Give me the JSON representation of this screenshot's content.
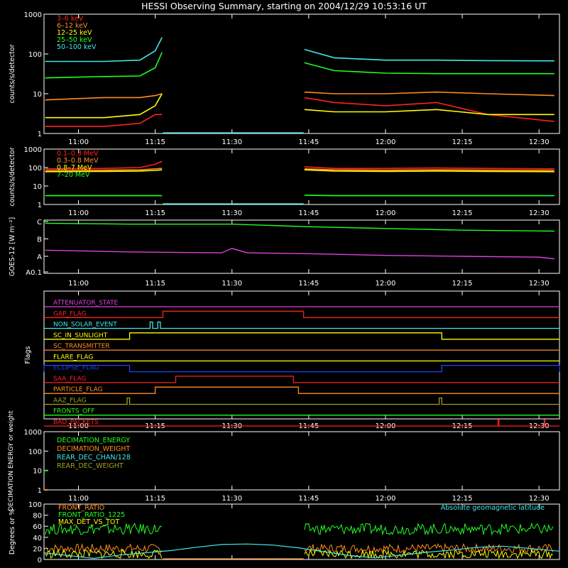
{
  "title": "HESSI Observing Summary, starting on 2004/12/29 10:53:16 UT",
  "time_ticks": [
    "11:00",
    "11:15",
    "11:30",
    "11:45",
    "12:00",
    "12:15",
    "12:30"
  ],
  "colors": {
    "red": "#ff2020",
    "orange": "#ff8c20",
    "yellow": "#ffff00",
    "green": "#20ff20",
    "cyan": "#40e8e8",
    "magenta": "#e040e0",
    "blue": "#2040ff",
    "olive": "#a0a020",
    "grey": "#a8a8a8"
  },
  "chart_data": [
    {
      "type": "line",
      "panel": "lightcurves-low",
      "ylabel": "counts/s/detector",
      "yscale": "log",
      "ylim": [
        1,
        1000
      ],
      "yticks": [
        "1",
        "10",
        "100",
        "1000"
      ],
      "xlim": [
        "10:53:16",
        "12:34:00"
      ],
      "gaps": [
        [
          "11:16:30",
          "11:44:00"
        ]
      ],
      "series": [
        {
          "name": "3–6 keV",
          "color": "#ff2020",
          "t": [
            "10:53:30",
            "11:05",
            "11:12",
            "11:15",
            "11:16:20",
            "11:44:10",
            "11:50",
            "12:00",
            "12:10",
            "12:20",
            "12:33"
          ],
          "values": [
            1.5,
            1.5,
            1.8,
            3,
            3,
            8,
            6,
            5,
            6,
            3,
            2
          ]
        },
        {
          "name": "6–12 keV",
          "color": "#ff8c20",
          "t": [
            "10:53:30",
            "11:05",
            "11:12",
            "11:15",
            "11:16:20",
            "11:44:10",
            "11:50",
            "12:00",
            "12:10",
            "12:20",
            "12:33"
          ],
          "values": [
            7,
            8,
            8,
            9,
            10,
            11,
            10,
            10,
            11,
            10,
            9
          ]
        },
        {
          "name": "12–25 keV",
          "color": "#ffff00",
          "t": [
            "10:53:30",
            "11:05",
            "11:12",
            "11:15",
            "11:16:20",
            "11:44:10",
            "11:50",
            "12:00",
            "12:10",
            "12:20",
            "12:33"
          ],
          "values": [
            2.5,
            2.5,
            3,
            5,
            10,
            4,
            3.5,
            3.5,
            4,
            3,
            3
          ]
        },
        {
          "name": "25–50 keV",
          "color": "#20ff20",
          "t": [
            "10:53:30",
            "11:05",
            "11:12",
            "11:15",
            "11:16:20",
            "11:44:10",
            "11:50",
            "12:00",
            "12:10",
            "12:20",
            "12:33"
          ],
          "values": [
            25,
            27,
            28,
            45,
            110,
            60,
            38,
            33,
            32,
            32,
            32
          ]
        },
        {
          "name": "50–100 keV",
          "color": "#40e8e8",
          "t": [
            "10:53:30",
            "11:05",
            "11:12",
            "11:15",
            "11:16:20",
            "11:44:10",
            "11:50",
            "12:00",
            "12:10",
            "12:20",
            "12:33"
          ],
          "values": [
            65,
            65,
            70,
            120,
            260,
            130,
            80,
            70,
            70,
            68,
            67
          ]
        }
      ]
    },
    {
      "type": "line",
      "panel": "lightcurves-high",
      "ylabel": "counts/s/detector",
      "yscale": "log",
      "ylim": [
        1,
        1000
      ],
      "yticks": [
        "1",
        "10",
        "100",
        "1000"
      ],
      "gaps": [
        [
          "11:16:30",
          "11:44:00"
        ]
      ],
      "series": [
        {
          "name": "0.1–0.3 MeV",
          "color": "#ff2020",
          "t": [
            "10:53:30",
            "11:05",
            "11:12",
            "11:15",
            "11:16:20",
            "11:44:10",
            "11:50",
            "12:00",
            "12:10",
            "12:20",
            "12:33"
          ],
          "values": [
            85,
            90,
            100,
            150,
            220,
            110,
            90,
            90,
            95,
            90,
            85
          ]
        },
        {
          "name": "0.3–0.8 MeV",
          "color": "#ff8c20",
          "t": [
            "10:53:30",
            "11:05",
            "11:12",
            "11:15",
            "11:16:20",
            "11:44:10",
            "11:50",
            "12:00",
            "12:10",
            "12:20",
            "12:33"
          ],
          "values": [
            70,
            72,
            75,
            85,
            90,
            85,
            75,
            72,
            75,
            72,
            70
          ]
        },
        {
          "name": "0.8–7 MeV",
          "color": "#ffff00",
          "t": [
            "10:53:30",
            "11:05",
            "11:12",
            "11:15",
            "11:16:20",
            "11:44:10",
            "11:50",
            "12:00",
            "12:10",
            "12:20",
            "12:33"
          ],
          "values": [
            60,
            62,
            65,
            70,
            75,
            75,
            65,
            62,
            65,
            62,
            60
          ]
        },
        {
          "name": "7–20 MeV",
          "color": "#20ff20",
          "t": [
            "10:53:30",
            "11:05",
            "11:12",
            "11:15",
            "11:16:20",
            "11:44:10",
            "11:50",
            "12:00",
            "12:10",
            "12:20",
            "12:33"
          ],
          "values": [
            3,
            3,
            3,
            3,
            3,
            3.2,
            3,
            3,
            3,
            3,
            3
          ]
        }
      ]
    },
    {
      "type": "line",
      "panel": "goes",
      "ylabel": "GOES-12 [W m⁻²]",
      "yscale": "log-class",
      "yticks": [
        "A0.1",
        "A",
        "B",
        "C"
      ],
      "series": [
        {
          "name": "",
          "color": "#20ff20",
          "t": [
            "10:53:30",
            "11:10",
            "11:30",
            "11:45",
            "12:00",
            "12:15",
            "12:33"
          ],
          "values_class": [
            2.9,
            2.85,
            2.85,
            2.7,
            2.6,
            2.5,
            2.45
          ]
        },
        {
          "name": "",
          "color": "#e040e0",
          "t": [
            "10:53:30",
            "11:10",
            "11:28",
            "11:30",
            "11:33",
            "11:45",
            "12:00",
            "12:15",
            "12:30",
            "12:33"
          ],
          "values_class": [
            1.35,
            1.25,
            1.2,
            1.45,
            1.2,
            1.15,
            1.05,
            1.0,
            0.95,
            0.85
          ]
        }
      ]
    },
    {
      "type": "line",
      "panel": "flags",
      "ylabel": "Flags",
      "flags": [
        {
          "name": "ATTENUATOR_STATE",
          "color": "#e040e0",
          "on": []
        },
        {
          "name": "GAP_FLAG",
          "color": "#ff2020",
          "on": [
            [
              "11:16:30",
              "11:44:00"
            ]
          ]
        },
        {
          "name": "NON_SOLAR_EVENT",
          "color": "#40e8e8",
          "on": [
            [
              "11:14:00",
              "11:14:30"
            ],
            [
              "11:15:30",
              "11:16:00"
            ]
          ]
        },
        {
          "name": "SC_IN_SUNLIGHT",
          "color": "#ffff00",
          "on": [
            [
              "11:10:00",
              "12:11:00"
            ]
          ]
        },
        {
          "name": "SC_TRANSMITTER",
          "color": "#ff8c20",
          "on": []
        },
        {
          "name": "FLARE_FLAG",
          "color": "#ffff00",
          "on": []
        },
        {
          "name": "ECLIPSE_FLAG",
          "color": "#2040ff",
          "on": [
            [
              "10:53:16",
              "11:10:00"
            ],
            [
              "12:11:00",
              "12:34:00"
            ]
          ]
        },
        {
          "name": "SAA_FLAG",
          "color": "#ff2020",
          "on": [
            [
              "11:19:00",
              "11:42:00"
            ]
          ]
        },
        {
          "name": "PARTICLE_FLAG",
          "color": "#ff8c20",
          "on": [
            [
              "11:15:00",
              "11:43:00"
            ]
          ]
        },
        {
          "name": "AAZ_FLAG",
          "color": "#a0a020",
          "on": [
            [
              "11:09:30",
              "11:10:00"
            ],
            [
              "12:10:30",
              "12:11:00"
            ]
          ]
        },
        {
          "name": "FRONTS_OFF",
          "color": "#20ff20",
          "on": []
        },
        {
          "name": "BAD_PACKETS",
          "color": "#ff2020",
          "on": [
            [
              "12:22:00",
              "12:22:10"
            ],
            [
              "12:31:00",
              "12:31:10"
            ]
          ]
        }
      ]
    },
    {
      "type": "line",
      "panel": "decimation",
      "ylabel": "DECIMATION ENERGY or weight",
      "yscale": "log",
      "yticks": [
        "1",
        "10",
        "100",
        "1000"
      ],
      "series": [
        {
          "name": "DECIMATION_ENERGY",
          "color": "#20ff20",
          "t": [
            "10:53:16",
            "10:54:00"
          ],
          "values": [
            10,
            10
          ]
        },
        {
          "name": "DECIMATION_WEIGHT",
          "color": "#ff8c20",
          "t": [
            "10:53:16",
            "10:54:00"
          ],
          "values": [
            1,
            1
          ]
        },
        {
          "name": "REAR_DEC_CHAN/128",
          "color": "#40e8e8",
          "t": [],
          "values": []
        },
        {
          "name": "REAR_DEC_WEIGHT",
          "color": "#a0a020",
          "t": [],
          "values": []
        }
      ]
    },
    {
      "type": "line",
      "panel": "ratios",
      "ylabel": "Degrees or %",
      "ylim": [
        0,
        100
      ],
      "yticks": [
        "0",
        "20",
        "40",
        "60",
        "80",
        "100"
      ],
      "annotation": "Absolute geomagnetic latitude",
      "series": [
        {
          "name": "FRONT_RATIO",
          "color": "#ff8c20",
          "t": [
            "10:53:30",
            "11:16:20",
            "11:44:10",
            "12:33"
          ],
          "values": [
            20,
            20,
            20,
            20
          ]
        },
        {
          "name": "FRONT_RATIO_1225",
          "color": "#20ff20",
          "t": [
            "10:53:30",
            "11:16:20",
            "11:44:10",
            "12:33"
          ],
          "values": [
            55,
            55,
            55,
            55
          ]
        },
        {
          "name": "MAX_DET_VS_TOT",
          "color": "#ffff00",
          "t": [
            "10:53:30",
            "11:16:20",
            "11:44:10",
            "12:33"
          ],
          "values": [
            10,
            10,
            10,
            10
          ]
        },
        {
          "name": "",
          "color": "#40e8e8",
          "t": [
            "10:53:16",
            "10:58",
            "11:03",
            "11:08",
            "11:13",
            "11:18",
            "11:23",
            "11:28",
            "11:33",
            "11:38",
            "11:43",
            "11:48",
            "11:53",
            "11:58",
            "12:03",
            "12:08",
            "12:13",
            "12:18",
            "12:23",
            "12:28",
            "12:34"
          ],
          "values": [
            12,
            7,
            2,
            8,
            12,
            16,
            22,
            27,
            28,
            26,
            21,
            14,
            7,
            3,
            8,
            13,
            17,
            22,
            24,
            20,
            15
          ]
        }
      ]
    }
  ]
}
